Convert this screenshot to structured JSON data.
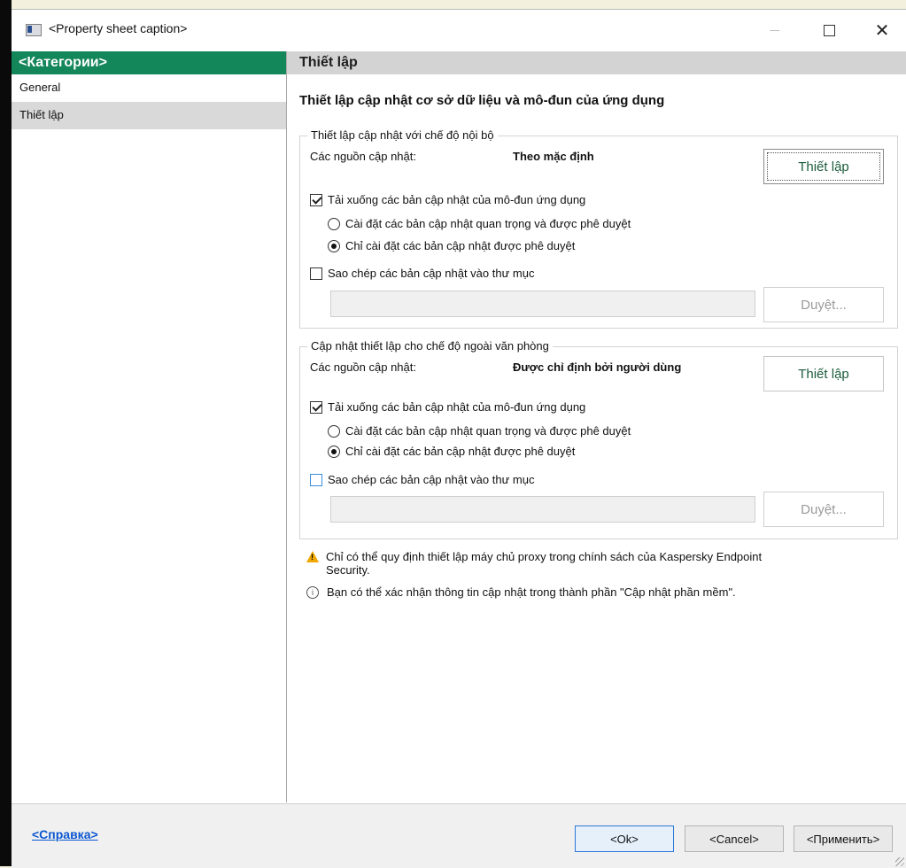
{
  "window": {
    "title": "<Property sheet caption>",
    "minimize": "—",
    "maximize": "☐",
    "close": "✕"
  },
  "sidebar": {
    "header": "<Категории>",
    "items": [
      {
        "label": "General",
        "selected": false
      },
      {
        "label": "Thiết lập",
        "selected": true
      }
    ]
  },
  "main": {
    "section_header": "Thiết lập",
    "page_title": "Thiết lập cập nhật cơ sở dữ liệu và mô-đun của ứng dụng",
    "internal": {
      "legend": "Thiết lập cập nhật với chế độ nội bộ",
      "sources_label": "Các nguồn cập nhật:",
      "sources_value": "Theo mặc định",
      "settings_button": "Thiết lập",
      "download_modules": {
        "label": "Tải xuống các bản cập nhật của mô-đun ứng dụng",
        "checked": true
      },
      "radio_critical": {
        "label": "Cài đặt các bản cập nhật quan trọng và được phê duyệt",
        "checked": false
      },
      "radio_approved": {
        "label": "Chỉ cài đặt các bản cập nhật được phê duyệt",
        "checked": true
      },
      "copy_updates": {
        "label": "Sao chép các bản cập nhật vào thư mục",
        "checked": false
      },
      "browse_button": "Duyệt..."
    },
    "outside": {
      "legend": "Cập nhật thiết lập cho chế độ ngoài văn phòng",
      "sources_label": "Các nguồn cập nhật:",
      "sources_value": "Được chỉ định bởi người dùng",
      "settings_button": "Thiết lập",
      "download_modules": {
        "label": "Tải xuống các bản cập nhật của mô-đun ứng dụng",
        "checked": true
      },
      "radio_critical": {
        "label": "Cài đặt các bản cập nhật quan trọng và được phê duyệt",
        "checked": false
      },
      "radio_approved": {
        "label": "Chỉ cài đặt các bản cập nhật được phê duyệt",
        "checked": true
      },
      "copy_updates": {
        "label": "Sao chép các bản cập nhật vào thư mục",
        "checked": false
      },
      "browse_button": "Duyệt..."
    },
    "warning_note_line1": "Chỉ có thể quy định thiết lập máy chủ proxy trong chính sách của Kaspersky Endpoint",
    "warning_note_line2": "Security.",
    "info_note": "Bạn có thể xác nhận thông tin cập nhật trong thành phần \"Cập nhật phần mềm\"."
  },
  "footer": {
    "help": "<Справка>",
    "ok": "<Ok>",
    "cancel": "<Cancel>",
    "apply": "<Применить>"
  },
  "colors": {
    "category_header": "#13865a",
    "section_header": "#d3d3d3",
    "link": "#0b57d0",
    "button_text": "#1c5d3c"
  },
  "icons": {
    "app": "property-sheet-icon",
    "warning": "warning-icon",
    "info": "info-icon"
  }
}
